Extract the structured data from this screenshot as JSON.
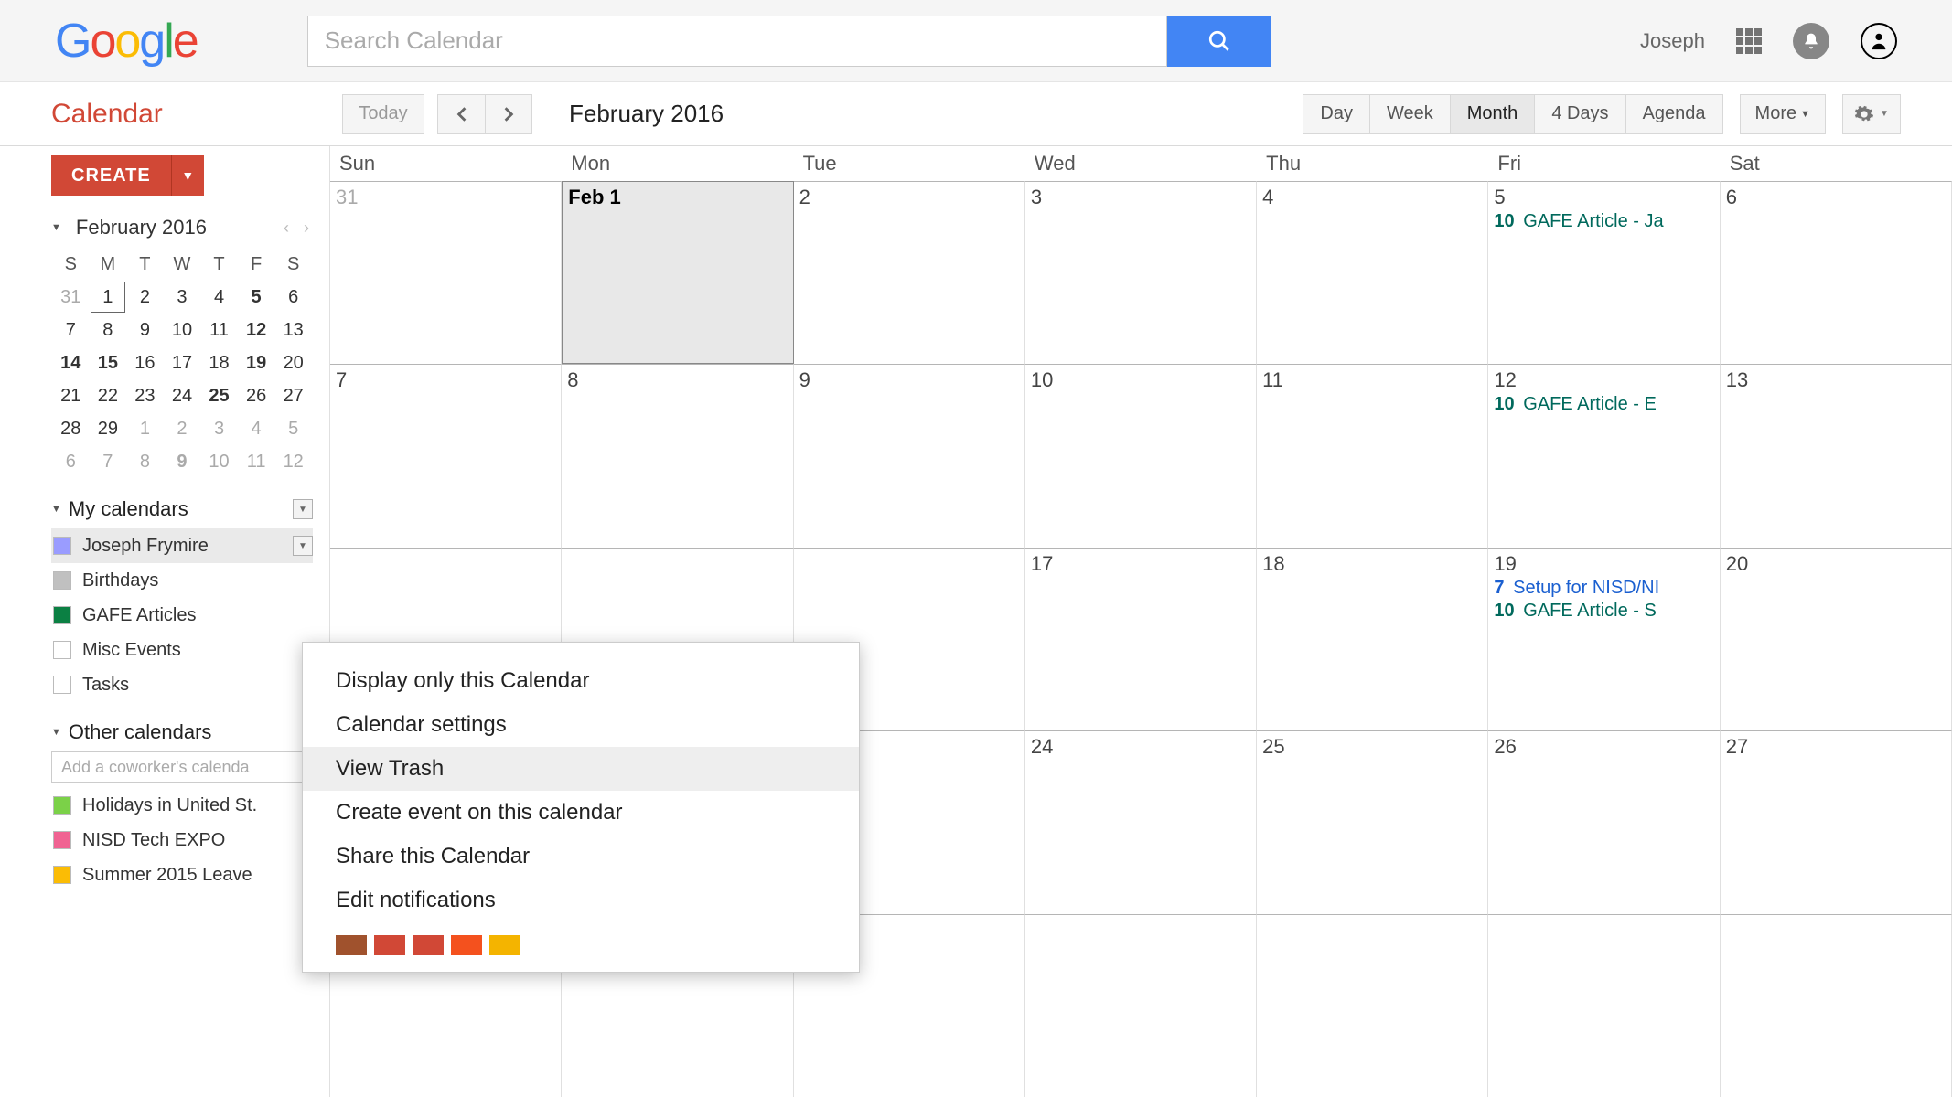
{
  "topbar": {
    "search_placeholder": "Search Calendar",
    "user_name": "Joseph"
  },
  "toolbar": {
    "app_title": "Calendar",
    "today": "Today",
    "current_month": "February 2016",
    "views": [
      "Day",
      "Week",
      "Month",
      "4 Days",
      "Agenda"
    ],
    "active_view": "Month",
    "more": "More"
  },
  "sidebar": {
    "create": "CREATE",
    "mini_month": "February 2016",
    "dow": [
      "S",
      "M",
      "T",
      "W",
      "T",
      "F",
      "S"
    ],
    "mini_weeks": [
      [
        {
          "d": "31",
          "o": true
        },
        {
          "d": "1",
          "today": true
        },
        {
          "d": "2"
        },
        {
          "d": "3"
        },
        {
          "d": "4"
        },
        {
          "d": "5",
          "b": true
        },
        {
          "d": "6"
        }
      ],
      [
        {
          "d": "7"
        },
        {
          "d": "8"
        },
        {
          "d": "9"
        },
        {
          "d": "10"
        },
        {
          "d": "11"
        },
        {
          "d": "12",
          "b": true
        },
        {
          "d": "13"
        }
      ],
      [
        {
          "d": "14",
          "b": true
        },
        {
          "d": "15",
          "b": true
        },
        {
          "d": "16"
        },
        {
          "d": "17"
        },
        {
          "d": "18"
        },
        {
          "d": "19",
          "b": true
        },
        {
          "d": "20"
        }
      ],
      [
        {
          "d": "21"
        },
        {
          "d": "22"
        },
        {
          "d": "23"
        },
        {
          "d": "24"
        },
        {
          "d": "25",
          "b": true
        },
        {
          "d": "26"
        },
        {
          "d": "27"
        }
      ],
      [
        {
          "d": "28"
        },
        {
          "d": "29"
        },
        {
          "d": "1",
          "o": true
        },
        {
          "d": "2",
          "o": true
        },
        {
          "d": "3",
          "o": true
        },
        {
          "d": "4",
          "o": true
        },
        {
          "d": "5",
          "o": true
        }
      ],
      [
        {
          "d": "6",
          "o": true
        },
        {
          "d": "7",
          "o": true
        },
        {
          "d": "8",
          "o": true
        },
        {
          "d": "9",
          "b": true,
          "o": true
        },
        {
          "d": "10",
          "o": true
        },
        {
          "d": "11",
          "o": true
        },
        {
          "d": "12",
          "o": true
        }
      ]
    ],
    "my_calendars_title": "My calendars",
    "my_calendars": [
      {
        "name": "Joseph Frymire",
        "color": "#9a9cff",
        "highlight": true,
        "dd": true
      },
      {
        "name": "Birthdays",
        "color": "#c0c0c0"
      },
      {
        "name": "GAFE Articles",
        "color": "#0b8043"
      },
      {
        "name": "Misc Events",
        "color": "#ffffff"
      },
      {
        "name": "Tasks",
        "color": "#ffffff"
      }
    ],
    "other_calendars_title": "Other calendars",
    "coworker_placeholder": "Add a coworker's calenda",
    "other_calendars": [
      {
        "name": "Holidays in United St.",
        "color": "#7bd148"
      },
      {
        "name": "NISD Tech EXPO",
        "color": "#f06292"
      },
      {
        "name": "Summer 2015 Leave",
        "color": "#fbbc05"
      }
    ]
  },
  "grid": {
    "dow": [
      "Sun",
      "Mon",
      "Tue",
      "Wed",
      "Thu",
      "Fri",
      "Sat"
    ],
    "weeks": [
      [
        {
          "label": "31",
          "other": true
        },
        {
          "label": "Feb 1",
          "selected": true
        },
        {
          "label": "2"
        },
        {
          "label": "3"
        },
        {
          "label": "4"
        },
        {
          "label": "5",
          "events": [
            {
              "time": "10",
              "title": "GAFE Article - Ja",
              "cls": "green"
            }
          ]
        },
        {
          "label": "6"
        }
      ],
      [
        {
          "label": "7"
        },
        {
          "label": "8"
        },
        {
          "label": "9"
        },
        {
          "label": "10"
        },
        {
          "label": "11"
        },
        {
          "label": "12",
          "events": [
            {
              "time": "10",
              "title": "GAFE Article - E",
              "cls": "green"
            }
          ]
        },
        {
          "label": "13"
        }
      ],
      [
        {
          "label": ""
        },
        {
          "label": ""
        },
        {
          "label": ""
        },
        {
          "label": "17"
        },
        {
          "label": "18"
        },
        {
          "label": "19",
          "events": [
            {
              "time": "7",
              "title": "Setup for NISD/NI",
              "cls": "blue"
            },
            {
              "time": "10",
              "title": "GAFE Article - S",
              "cls": "green"
            }
          ]
        },
        {
          "label": "20"
        }
      ],
      [
        {
          "label": ""
        },
        {
          "label": ""
        },
        {
          "label": ""
        },
        {
          "label": "24"
        },
        {
          "label": "25"
        },
        {
          "label": "26"
        },
        {
          "label": "27"
        }
      ],
      [
        {
          "label": ""
        },
        {
          "label": ""
        },
        {
          "label": ""
        },
        {
          "label": ""
        },
        {
          "label": ""
        },
        {
          "label": ""
        },
        {
          "label": ""
        }
      ]
    ]
  },
  "context_menu": {
    "items": [
      {
        "label": "Display only this Calendar"
      },
      {
        "label": "Calendar settings"
      },
      {
        "label": "View Trash",
        "highlight": true
      },
      {
        "label": "Create event on this calendar"
      },
      {
        "label": "Share this Calendar"
      },
      {
        "label": "Edit notifications"
      }
    ],
    "colors": [
      "#a0522d",
      "#d14836",
      "#d14836",
      "#f4511e",
      "#f4b400"
    ]
  }
}
